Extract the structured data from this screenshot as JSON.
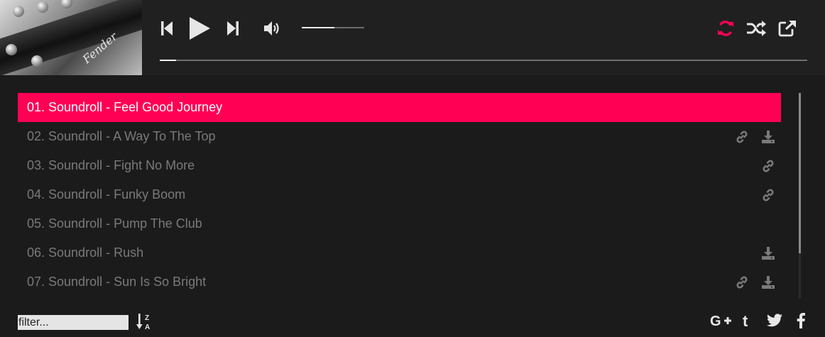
{
  "player": {
    "cover_alt": "Album cover",
    "cover_script": "Fender",
    "volume_level": 0.52,
    "progress_level": 0.025,
    "repeat_active_color": "#ff0055",
    "icon_color": "#e6e6e6"
  },
  "controls": {
    "prev_icon": "skip-previous-icon",
    "play_icon": "play-icon",
    "next_icon": "skip-next-icon",
    "volume_icon": "volume-icon",
    "repeat_icon": "repeat-icon",
    "shuffle_icon": "shuffle-icon",
    "popout_icon": "external-link-icon"
  },
  "playlist": {
    "accent": "#ff0055",
    "tracks": [
      {
        "title": "01. Soundroll - Feel Good Journey",
        "active": true,
        "link": false,
        "download": false
      },
      {
        "title": "02. Soundroll - A Way To The Top",
        "active": false,
        "link": true,
        "download": true
      },
      {
        "title": "03. Soundroll - Fight No More",
        "active": false,
        "link": true,
        "download": false
      },
      {
        "title": "04. Soundroll - Funky Boom",
        "active": false,
        "link": true,
        "download": false
      },
      {
        "title": "05. Soundroll - Pump The Club",
        "active": false,
        "link": false,
        "download": false
      },
      {
        "title": "06. Soundroll - Rush",
        "active": false,
        "link": false,
        "download": true
      },
      {
        "title": "07. Soundroll - Sun Is So Bright",
        "active": false,
        "link": true,
        "download": true
      }
    ]
  },
  "footer": {
    "filter_placeholder": "filter...",
    "sort_icon": "sort-alpha-desc-icon",
    "social": [
      "google-plus-icon",
      "tumblr-icon",
      "twitter-icon",
      "facebook-icon"
    ]
  }
}
